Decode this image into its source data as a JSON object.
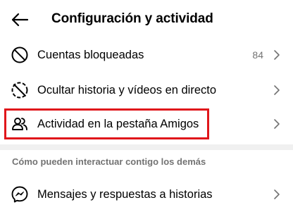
{
  "header": {
    "title": "Configuración y actividad",
    "back_icon": "arrow-left-icon"
  },
  "rows": [
    {
      "label": "Cuentas bloqueadas",
      "count": "84",
      "icon": "block-icon"
    },
    {
      "label": "Ocultar historia y vídeos en directo",
      "icon": "hide-story-icon"
    },
    {
      "label": "Actividad en la pestaña Amigos",
      "icon": "friends-icon",
      "highlighted": true
    }
  ],
  "section": {
    "heading": "Cómo pueden interactuar contigo los demás",
    "rows": [
      {
        "label": "Mensajes y respuestas a historias",
        "icon": "messenger-icon"
      }
    ]
  },
  "colors": {
    "highlight": "#e0161b",
    "muted_text": "#737373",
    "divider": "#f0f0f0"
  }
}
